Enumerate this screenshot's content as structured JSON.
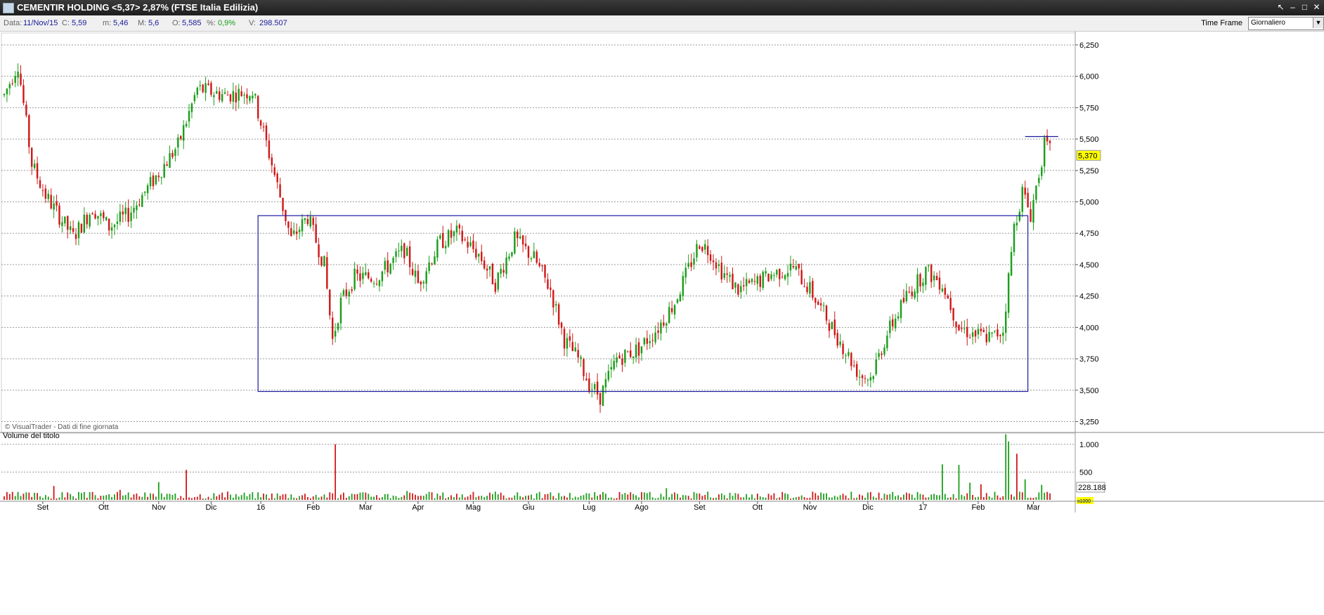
{
  "window": {
    "title": "CEMENTIR HOLDING <5,37> 2,87%  (FTSE Italia Edilizia)",
    "controls": [
      "↖",
      "–",
      "□",
      "✕"
    ]
  },
  "infobar": {
    "data_label": "Data:",
    "data_value": "11/Nov/15",
    "c_label": "C:",
    "c_value": "5,59",
    "m_label": "m:",
    "m_value": "5,46",
    "M_label": "M:",
    "M_value": "5,6",
    "o_label": "O:",
    "o_value": "5,585",
    "pct_label": "%:",
    "pct_value": "0,9%",
    "v_label": "V:",
    "v_value": "298.507",
    "timeframe_label": "Time Frame",
    "timeframe_value": "Giornaliero"
  },
  "colors": {
    "up": "#1a9e1a",
    "down": "#d01818",
    "box": "#1a1aa0",
    "grid": "#9a9a9a",
    "last_price_bg": "#ffff00",
    "info_value": "#1a1a9a",
    "pct_value": "#1a9e1a"
  },
  "chart_data": [
    {
      "type": "candlestick",
      "watermark": "© VisualTrader - Dati di fine giornata",
      "y_ticks": [
        3.25,
        3.5,
        3.75,
        4.0,
        4.25,
        4.5,
        4.75,
        5.0,
        5.25,
        5.5,
        5.75,
        6.0,
        6.25
      ],
      "y_tick_labels": [
        "3,250",
        "3,500",
        "3,750",
        "4,000",
        "4,250",
        "4,500",
        "4,750",
        "5,000",
        "5,250",
        "5,500",
        "5,750",
        "6,000",
        "6,250"
      ],
      "ylim": [
        3.18,
        6.3
      ],
      "last_price_label": "5,370",
      "last_price": 5.37,
      "month_labels": [
        "Set",
        "Ott",
        "Nov",
        "Dic",
        "16",
        "Feb",
        "Mar",
        "Apr",
        "Mag",
        "Giu",
        "Lug",
        "Ago",
        "Set",
        "Ott",
        "Nov",
        "Dic",
        "17",
        "Feb",
        "Mar"
      ],
      "month_positions": [
        14,
        36,
        56,
        75,
        93,
        112,
        131,
        150,
        170,
        190,
        212,
        231,
        252,
        273,
        292,
        313,
        333,
        353,
        373
      ],
      "bar_count": 380,
      "box": {
        "x_start": 92,
        "x_end": 371,
        "y_low": 3.49,
        "y_high": 4.89
      },
      "resistance_line": {
        "x_start": 370,
        "x_end": 382,
        "y": 5.52
      },
      "path_anchors": [
        [
          0,
          5.85
        ],
        [
          5,
          6.1
        ],
        [
          10,
          5.3
        ],
        [
          15,
          5.05
        ],
        [
          25,
          4.72
        ],
        [
          32,
          4.95
        ],
        [
          38,
          4.8
        ],
        [
          45,
          4.9
        ],
        [
          55,
          5.2
        ],
        [
          63,
          5.45
        ],
        [
          70,
          5.9
        ],
        [
          80,
          5.85
        ],
        [
          90,
          5.88
        ],
        [
          97,
          5.3
        ],
        [
          104,
          4.7
        ],
        [
          110,
          4.88
        ],
        [
          116,
          4.5
        ],
        [
          119,
          3.9
        ],
        [
          122,
          4.2
        ],
        [
          127,
          4.4
        ],
        [
          135,
          4.4
        ],
        [
          145,
          4.62
        ],
        [
          150,
          4.35
        ],
        [
          158,
          4.68
        ],
        [
          164,
          4.75
        ],
        [
          172,
          4.58
        ],
        [
          178,
          4.35
        ],
        [
          185,
          4.7
        ],
        [
          192,
          4.55
        ],
        [
          198,
          4.3
        ],
        [
          203,
          3.9
        ],
        [
          208,
          3.75
        ],
        [
          212,
          3.55
        ],
        [
          216,
          3.45
        ],
        [
          222,
          3.75
        ],
        [
          230,
          3.83
        ],
        [
          237,
          4.0
        ],
        [
          243,
          4.2
        ],
        [
          252,
          4.68
        ],
        [
          256,
          4.6
        ],
        [
          260,
          4.45
        ],
        [
          266,
          4.3
        ],
        [
          272,
          4.35
        ],
        [
          278,
          4.42
        ],
        [
          286,
          4.48
        ],
        [
          292,
          4.3
        ],
        [
          300,
          4.0
        ],
        [
          310,
          3.62
        ],
        [
          314,
          3.6
        ],
        [
          320,
          3.95
        ],
        [
          327,
          4.25
        ],
        [
          334,
          4.45
        ],
        [
          340,
          4.35
        ],
        [
          346,
          4.0
        ],
        [
          352,
          3.94
        ],
        [
          358,
          3.92
        ],
        [
          362,
          3.98
        ],
        [
          366,
          4.8
        ],
        [
          369,
          5.08
        ],
        [
          372,
          4.9
        ],
        [
          377,
          5.45
        ],
        [
          382,
          5.34
        ]
      ],
      "volume": {
        "label": "Volume del titolo",
        "y_ticks": [
          500,
          1000
        ],
        "y_tick_labels": [
          "500",
          "1.000"
        ],
        "ylim": [
          0,
          1200
        ],
        "last_label": "228.188",
        "unit_label": "x1000",
        "base_level": 90,
        "spikes": [
          [
            18,
            250
          ],
          [
            42,
            180
          ],
          [
            56,
            320
          ],
          [
            66,
            540
          ],
          [
            120,
            1000
          ],
          [
            146,
            160
          ],
          [
            240,
            210
          ],
          [
            340,
            640
          ],
          [
            346,
            630
          ],
          [
            350,
            310
          ],
          [
            354,
            280
          ],
          [
            363,
            1180
          ],
          [
            364,
            1050
          ],
          [
            367,
            830
          ],
          [
            370,
            370
          ],
          [
            376,
            270
          ]
        ]
      }
    }
  ]
}
